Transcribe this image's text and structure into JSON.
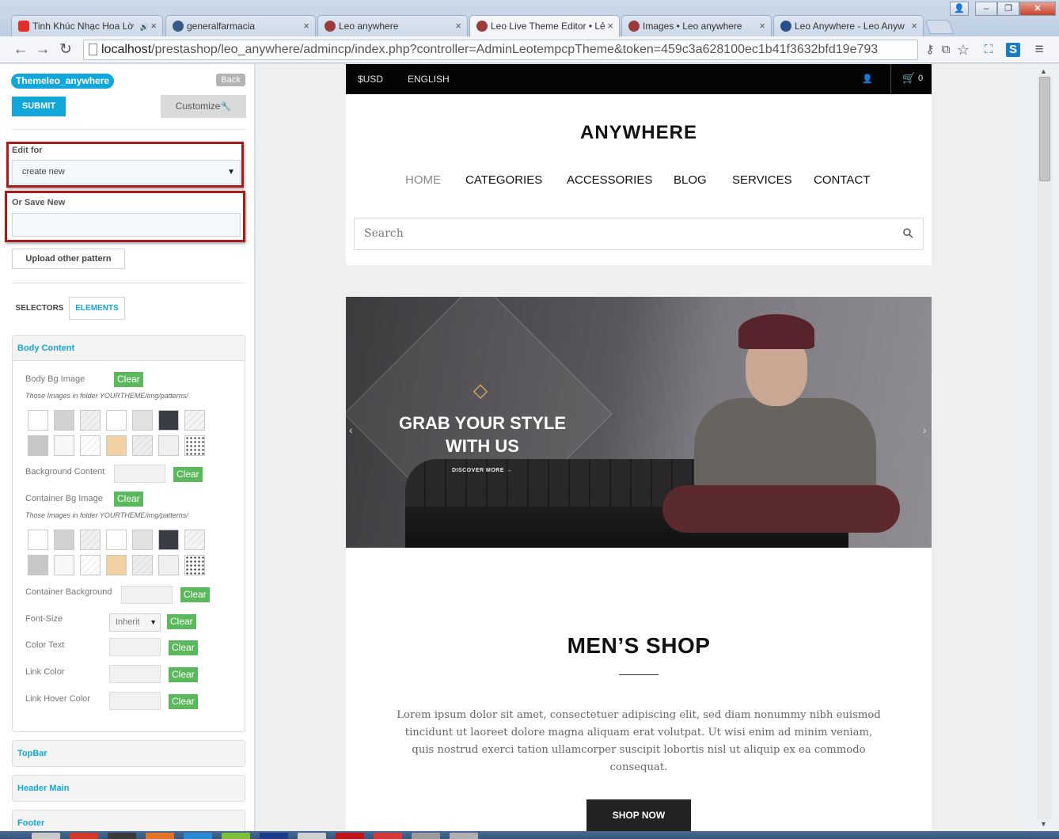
{
  "browser": {
    "tabs": [
      {
        "title": "Tinh Khúc Nhạc Hoa Lờ",
        "favicon_color": "#e52d27",
        "audio": true
      },
      {
        "title": "generalfarmacia",
        "favicon_color": "#3a5a86",
        "audio": false
      },
      {
        "title": "Leo anywhere",
        "favicon_color": "#9b3b3b",
        "audio": false
      },
      {
        "title": "Leo Live Theme Editor • Lẻ",
        "favicon_color": "#9b3b3b",
        "audio": false,
        "active": true
      },
      {
        "title": "Images • Leo anywhere",
        "favicon_color": "#9b3b3b",
        "audio": false
      },
      {
        "title": "Leo Anywhere - Leo Anyw",
        "favicon_color": "#2a4f8a",
        "audio": false
      }
    ],
    "tab_close_glyph": "×",
    "audio_glyph": "🔊",
    "window_controls": {
      "user": "👤",
      "minimize": "–",
      "maximize": "❐",
      "close": "✕"
    },
    "nav": {
      "back": "←",
      "forward": "→",
      "reload": "↻",
      "menu": "≡"
    },
    "url_host": "localhost",
    "url_path": "/prestashop/leo_anywhere/admincp/index.php?controller=AdminLeotempcpTheme&token=459c3a628100ec1b41f3632bfd19e793",
    "toolbar_icons": [
      "key-icon",
      "translate-icon",
      "star-icon",
      "screen-icon",
      "extension-icon"
    ],
    "toolbar_glyphs": {
      "key": "⚷",
      "translate": "⧉",
      "star": "☆",
      "screen": "⛶",
      "extension": "S"
    }
  },
  "editor": {
    "theme_name": "Themeleo_anywhere",
    "back_label": "Back",
    "submit_label": "SUBMIT",
    "customize_label": "Customize",
    "wrench_glyph": "🔧",
    "edit_for_label": "Edit for",
    "edit_for_value": "create new",
    "select_caret": "▼",
    "save_new_label": "Or Save New",
    "save_new_value": "",
    "upload_label": "Upload other pattern",
    "tabs": {
      "selectors": "SELECTORS",
      "elements": "ELEMENTS"
    },
    "highlight_color": "#a71c1c",
    "accent_color": "#11a7db",
    "clear_color": "#5cb85c",
    "body_content": {
      "title": "Body Content",
      "body_bg_image": "Body Bg Image",
      "patterns_note": "Those Images in folder YOURTHEME/img/patterns/",
      "background_content": "Background Content",
      "container_bg_image": "Container Bg Image",
      "container_background": "Container Background",
      "font_size": "Font-Size",
      "font_size_value": "Inherit",
      "color_text": "Color Text",
      "link_color": "Link Color",
      "link_hover_color": "Link Hover Color",
      "clear_label": "Clear"
    },
    "pattern_swatches": [
      "#ffffff",
      "#d2d2d2",
      "#f1f1f1",
      "#ffffff",
      "#e2e2e2",
      "#3a3d45",
      "#f5f5f5",
      "#c7c7c7",
      "#f7f7f7",
      "#ffffff",
      "#f2d2a2",
      "#eeeeee",
      "#f0f0f0",
      "#9a9a9a"
    ],
    "sections": [
      "TopBar",
      "Header Main",
      "Footer"
    ]
  },
  "site": {
    "currency": "$USD",
    "language": "ENGLISH",
    "user_glyph": "👤",
    "cart_glyph": "🛒",
    "cart_count": "0",
    "logo": "ANYWHERE",
    "menu": [
      "HOME",
      "CATEGORIES",
      "ACCESSORIES",
      "BLOG",
      "SERVICES",
      "CONTACT"
    ],
    "menu_active_color": "#8a8a8a",
    "search_placeholder": "Search",
    "search_glyph": "⚲",
    "slide": {
      "icon_glyph": "◇",
      "title_line1": "GRAB YOUR STYLE",
      "title_line2": "WITH US",
      "link": "DISCOVER MORE →",
      "prev_glyph": "‹",
      "next_glyph": "›"
    },
    "section_title": "MEN’S SHOP",
    "section_text": "Lorem ipsum dolor sit amet, consectetuer adipiscing elit, sed diam nonummy nibh euismod tincidunt ut laoreet dolore magna aliquam erat volutpat. Ut wisi enim ad minim veniam, quis nostrud exerci tation ullamcorper suscipit lobortis nisl ut aliquip ex ea commodo consequat.",
    "shop_now": "SHOP NOW"
  },
  "scroll": {
    "up": "▲",
    "down": "▼"
  },
  "taskbar_colors": [
    "#c9c9c9",
    "#d33a2c",
    "#3a3a3a",
    "#e4732a",
    "#2a8ad4",
    "#7bbf3a",
    "#1e3a8a",
    "#cfcfcf",
    "#c0161b",
    "#d63a3a",
    "#9a9a9a",
    "#b0b0b0"
  ]
}
